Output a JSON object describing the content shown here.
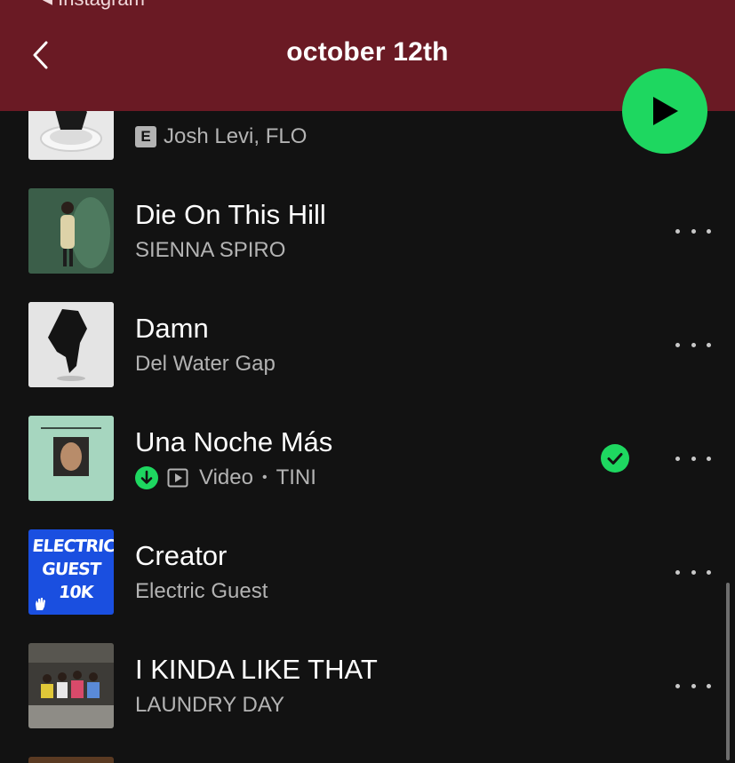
{
  "status_bar": {
    "back_app": "◂ Instagram"
  },
  "header": {
    "title": "october 12th"
  },
  "tracks": [
    {
      "title": "",
      "artist": "Josh Levi, FLO",
      "explicit_label": "E"
    },
    {
      "title": "Die On This Hill",
      "artist": "SIENNA SPIRO"
    },
    {
      "title": "Damn",
      "artist": "Del Water Gap"
    },
    {
      "title": "Una Noche Más",
      "video_label": "Video",
      "separator": "•",
      "artist": "TINI"
    },
    {
      "title": "Creator",
      "artist": "Electric Guest",
      "art_text": [
        "ELECTRIC",
        "GUEST",
        "10K"
      ]
    },
    {
      "title": "I KINDA LIKE THAT",
      "artist": "LAUNDRY DAY"
    }
  ],
  "colors": {
    "header": "#6a1a24",
    "accent": "#1ed760",
    "background": "#121212",
    "secondary_text": "#b3b3b3"
  },
  "icons": {
    "back": "chevron-left-icon",
    "play": "play-icon",
    "more": "more-horizontal-icon",
    "downloaded": "download-icon",
    "video": "video-icon",
    "added": "check-circle-icon"
  }
}
